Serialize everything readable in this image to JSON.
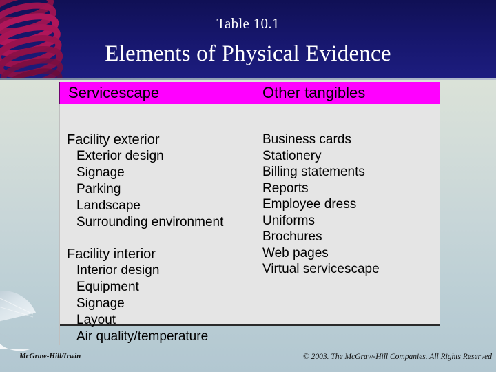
{
  "header": {
    "table_number": "Table 10.1",
    "title": "Elements of Physical Evidence",
    "background_color": "#16166b",
    "accent_color": "#a01050"
  },
  "table": {
    "header_background": "#ff00ff",
    "body_background": "#e5e5e5",
    "columns": [
      {
        "label": "Servicescape"
      },
      {
        "label": "Other tangibles"
      }
    ],
    "servicescape": {
      "groups": [
        {
          "heading": "Facility exterior",
          "items": [
            "Exterior design",
            "Signage",
            "Parking",
            "Landscape",
            "Surrounding environment"
          ]
        },
        {
          "heading": "Facility interior",
          "items": [
            "Interior design",
            "Equipment",
            "Signage",
            "Layout",
            "Air quality/temperature"
          ]
        }
      ]
    },
    "other_tangibles": {
      "items": [
        "Business cards",
        "Stationery",
        "Billing statements",
        "Reports",
        "Employee dress",
        "Uniforms",
        "Brochures",
        "Web pages",
        "Virtual servicescape"
      ]
    }
  },
  "footer": {
    "publisher": "McGraw-Hill/Irwin",
    "copyright": "© 2003. The McGraw-Hill Companies. All Rights Reserved"
  }
}
